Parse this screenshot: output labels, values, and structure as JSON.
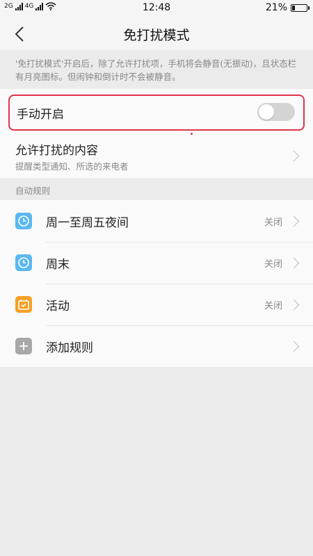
{
  "status": {
    "net1": "2G",
    "net2": "4G",
    "time": "12:48",
    "battery": "21%",
    "battery_level": 0.21
  },
  "nav": {
    "title": "免打扰模式",
    "back_icon": "chevron-left-icon"
  },
  "description": "'免打扰模式'开启后，除了允许打扰项，手机将会静音(无振动)，且状态栏有月亮图标。但闹钟和倒计时不会被静音。",
  "manual": {
    "label": "手动开启",
    "enabled": false
  },
  "allow": {
    "title": "允许打扰的内容",
    "subtitle": "提醒类型通知、所选的来电者"
  },
  "auto_rules": {
    "header": "自动规则",
    "items": [
      {
        "label": "周一至周五夜间",
        "state": "关闭",
        "icon": "clock-icon",
        "color": "#5bb8f0"
      },
      {
        "label": "周末",
        "state": "关闭",
        "icon": "clock-icon",
        "color": "#5bb8f0"
      },
      {
        "label": "活动",
        "state": "关闭",
        "icon": "calendar-icon",
        "color": "#f6a025"
      },
      {
        "label": "添加规则",
        "state": "",
        "icon": "plus-icon",
        "color": "#a8a8a8"
      }
    ]
  },
  "colors": {
    "highlight": "#e2334c",
    "background": "#ebebeb",
    "card": "#fafafa"
  }
}
